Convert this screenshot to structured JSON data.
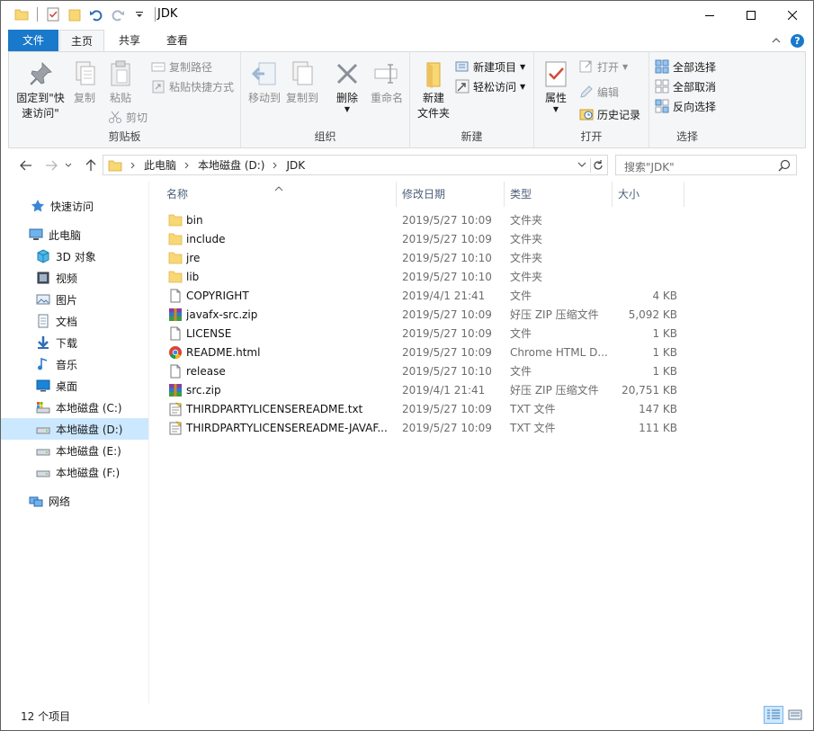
{
  "window": {
    "title": "JDK"
  },
  "ribbon_tabs": {
    "file": "文件",
    "home": "主页",
    "share": "共享",
    "view": "查看",
    "help": "?"
  },
  "ribbon": {
    "clipboard": {
      "label": "剪贴板",
      "pin_line1": "固定到\"快",
      "pin_line2": "速访问\"",
      "copy": "复制",
      "paste": "粘贴",
      "copy_path": "复制路径",
      "paste_shortcut": "粘贴快捷方式",
      "cut": "剪切"
    },
    "organize": {
      "label": "组织",
      "move_to": "移动到",
      "copy_to": "复制到",
      "delete": "删除",
      "rename": "重命名"
    },
    "new": {
      "label": "新建",
      "new_folder_line1": "新建",
      "new_folder_line2": "文件夹",
      "new_item": "新建项目",
      "easy_access": "轻松访问"
    },
    "open": {
      "label": "打开",
      "properties": "属性",
      "open": "打开",
      "edit": "编辑",
      "history": "历史记录"
    },
    "select": {
      "label": "选择",
      "select_all": "全部选择",
      "select_none": "全部取消",
      "invert": "反向选择"
    }
  },
  "address": {
    "segments": [
      "此电脑",
      "本地磁盘 (D:)",
      "JDK"
    ],
    "search_placeholder": "搜索\"JDK\""
  },
  "nav": {
    "quick_access": "快速访问",
    "this_pc": "此电脑",
    "objects3d": "3D 对象",
    "videos": "视频",
    "pictures": "图片",
    "documents": "文档",
    "downloads": "下载",
    "music": "音乐",
    "desktop": "桌面",
    "drive_c": "本地磁盘 (C:)",
    "drive_d": "本地磁盘 (D:)",
    "drive_e": "本地磁盘 (E:)",
    "drive_f": "本地磁盘 (F:)",
    "network": "网络"
  },
  "columns": {
    "name": "名称",
    "date": "修改日期",
    "type": "类型",
    "size": "大小"
  },
  "files": [
    {
      "name": "bin",
      "date": "2019/5/27 10:09",
      "type": "文件夹",
      "size": "",
      "icon": "folder-icon"
    },
    {
      "name": "include",
      "date": "2019/5/27 10:09",
      "type": "文件夹",
      "size": "",
      "icon": "folder-icon"
    },
    {
      "name": "jre",
      "date": "2019/5/27 10:10",
      "type": "文件夹",
      "size": "",
      "icon": "folder-icon"
    },
    {
      "name": "lib",
      "date": "2019/5/27 10:10",
      "type": "文件夹",
      "size": "",
      "icon": "folder-icon"
    },
    {
      "name": "COPYRIGHT",
      "date": "2019/4/1 21:41",
      "type": "文件",
      "size": "4 KB",
      "icon": "file-icon"
    },
    {
      "name": "javafx-src.zip",
      "date": "2019/5/27 10:09",
      "type": "好压 ZIP 压缩文件",
      "size": "5,092 KB",
      "icon": "zip-icon"
    },
    {
      "name": "LICENSE",
      "date": "2019/5/27 10:09",
      "type": "文件",
      "size": "1 KB",
      "icon": "file-icon"
    },
    {
      "name": "README.html",
      "date": "2019/5/27 10:09",
      "type": "Chrome HTML D...",
      "size": "1 KB",
      "icon": "chrome-icon"
    },
    {
      "name": "release",
      "date": "2019/5/27 10:10",
      "type": "文件",
      "size": "1 KB",
      "icon": "file-icon"
    },
    {
      "name": "src.zip",
      "date": "2019/4/1 21:41",
      "type": "好压 ZIP 压缩文件",
      "size": "20,751 KB",
      "icon": "zip-icon"
    },
    {
      "name": "THIRDPARTYLICENSEREADME.txt",
      "date": "2019/5/27 10:09",
      "type": "TXT 文件",
      "size": "147 KB",
      "icon": "txt-icon"
    },
    {
      "name": "THIRDPARTYLICENSEREADME-JAVAF...",
      "date": "2019/5/27 10:09",
      "type": "TXT 文件",
      "size": "111 KB",
      "icon": "txt-icon"
    }
  ],
  "status": {
    "count": "12 个项目"
  },
  "colors": {
    "accent": "#1979ca",
    "selection": "#cce8ff",
    "folder": "#f8d775",
    "header_text": "#4c607a"
  }
}
